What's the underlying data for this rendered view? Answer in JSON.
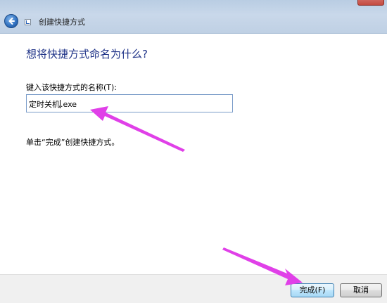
{
  "titlebar": {
    "title": "创建快捷方式"
  },
  "main": {
    "heading": "想将快捷方式命名为什么?",
    "name_label": "键入该快捷方式的名称(T):",
    "name_value_before_caret": "定时关机",
    "name_value_after_caret": ".exe",
    "hint": "单击“完成”创建快捷方式。"
  },
  "footer": {
    "finish_label": "完成(F)",
    "cancel_label": "取消"
  },
  "colors": {
    "heading": "#1e3287",
    "annotation_arrow": "#e040e8"
  },
  "icons": [
    "back-arrow-icon",
    "shortcut-icon"
  ]
}
